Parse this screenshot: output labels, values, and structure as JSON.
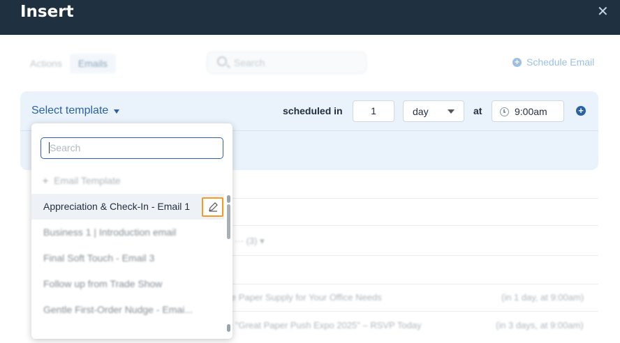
{
  "header": {
    "title": "Insert",
    "close_icon": "close-icon"
  },
  "tabs": [
    {
      "label": "Actions",
      "active": false
    },
    {
      "label": "Emails",
      "active": true
    }
  ],
  "search": {
    "placeholder": "Search"
  },
  "schedule_email": {
    "label": "Schedule Email"
  },
  "step": {
    "select_template_label": "Select template",
    "scheduled_in_label": "scheduled in",
    "delay_value": "1",
    "delay_unit": "day",
    "at_label": "at",
    "time_value": "9:00am"
  },
  "dropdown": {
    "search_placeholder": "Search",
    "add_label": "Email Template",
    "items": [
      {
        "label": "Appreciation & Check-In - Email 1",
        "selected": true
      },
      {
        "label": "Business 1 | Introduction email"
      },
      {
        "label": "Final Soft Touch - Email 3"
      },
      {
        "label": "Follow up from Trade Show"
      },
      {
        "label": "Gentle First-Order Nudge - Emai..."
      }
    ]
  },
  "background_rows": [
    {
      "text": "··· (3) ▾",
      "timing": ""
    },
    {
      "text": "le Paper Supply for Your Office Needs",
      "timing": "(in 1 day, at 9:00am)"
    },
    {
      "text": "e \"Great Paper Push Expo 2025\" – RSVP Today",
      "timing": "(in 3 days, at 9:00am)"
    }
  ],
  "colors": {
    "header_bg": "#1f3140",
    "accent": "#2b62a5",
    "highlight_border": "#f59b23",
    "panel_bg": "#eaf2fb"
  }
}
